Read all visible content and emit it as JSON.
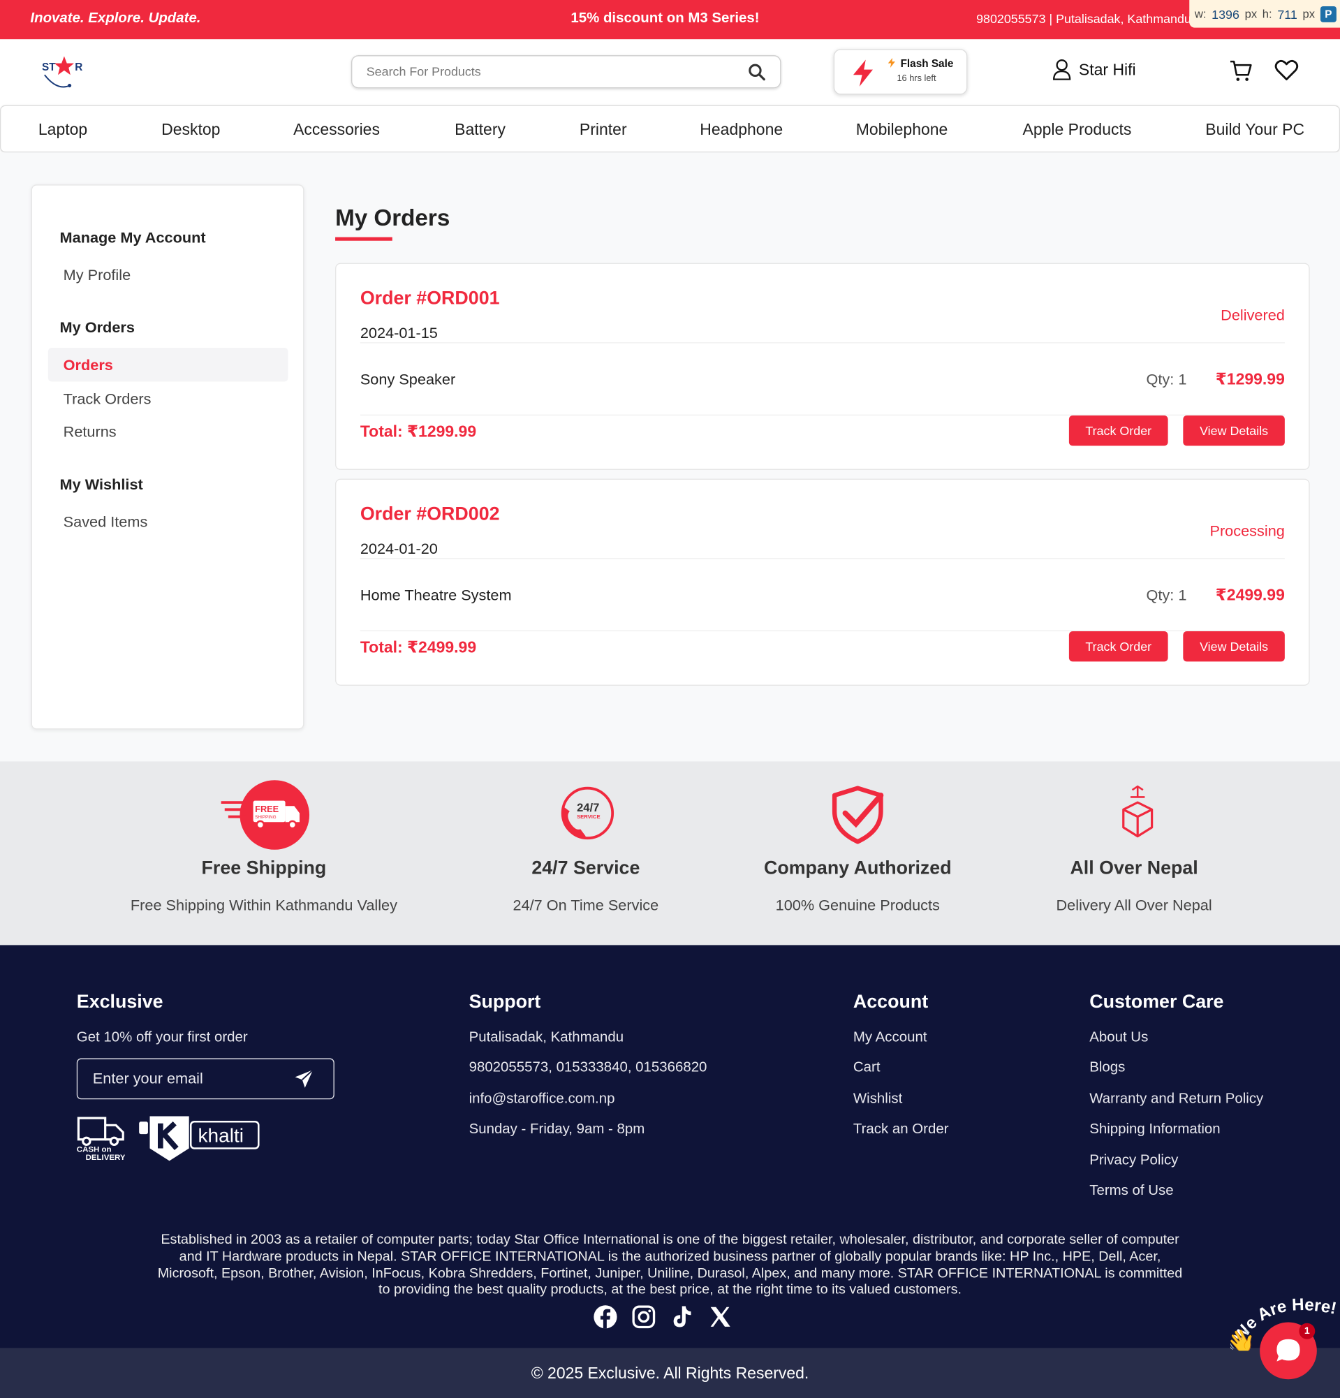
{
  "topbar": {
    "slogan": "Inovate. Explore. Update.",
    "promo": "15% discount on M3 Series!",
    "contact": "9802055573 | Putalisadak, Kathmandu",
    "dim_w_label": "w:",
    "dim_w_value": "1396",
    "dim_h_label": "h:",
    "dim_h_value": "711",
    "dim_unit": "px"
  },
  "header": {
    "search_placeholder": "Search For Products",
    "flash_title": "Flash Sale",
    "flash_sub": "16 hrs left",
    "user_name": "Star Hifi"
  },
  "nav": [
    "Laptop",
    "Desktop",
    "Accessories",
    "Battery",
    "Printer",
    "Headphone",
    "Mobilephone",
    "Apple Products",
    "Build Your PC"
  ],
  "sidebar": {
    "manage_title": "Manage My Account",
    "my_profile": "My Profile",
    "orders_title": "My Orders",
    "orders": "Orders",
    "track_orders": "Track Orders",
    "returns": "Returns",
    "wishlist_title": "My Wishlist",
    "saved_items": "Saved Items"
  },
  "page": {
    "title": "My Orders"
  },
  "orders": [
    {
      "id": "Order #ORD001",
      "date": "2024-01-15",
      "status": "Delivered",
      "item": "Sony Speaker",
      "qty": "Qty: 1",
      "price": "₹1299.99",
      "total": "Total: ₹1299.99",
      "track_label": "Track Order",
      "view_label": "View Details"
    },
    {
      "id": "Order #ORD002",
      "date": "2024-01-20",
      "status": "Processing",
      "item": "Home Theatre System",
      "qty": "Qty: 1",
      "price": "₹2499.99",
      "total": "Total: ₹2499.99",
      "track_label": "Track Order",
      "view_label": "View Details"
    }
  ],
  "features": [
    {
      "title": "Free Shipping",
      "sub": "Free Shipping Within Kathmandu Valley",
      "icon_text": "FREE",
      "icon_sub": "SHIPPING"
    },
    {
      "title": "24/7 Service",
      "sub": "24/7 On Time Service",
      "icon_text": "24/7",
      "icon_sub": "SERVICE"
    },
    {
      "title": "Company Authorized",
      "sub": "100% Genuine Products"
    },
    {
      "title": "All Over Nepal",
      "sub": "Delivery All Over Nepal"
    }
  ],
  "footer": {
    "exclusive": {
      "title": "Exclusive",
      "offer": "Get 10% off your first order",
      "email_placeholder": "Enter your email",
      "cod_line1": "CASH on",
      "cod_line2": "DELIVERY",
      "khalti": "khalti"
    },
    "support": {
      "title": "Support",
      "address": "Putalisadak, Kathmandu",
      "phones": "9802055573, 015333840, 015366820",
      "email": "info@staroffice.com.np",
      "hours": "Sunday - Friday, 9am - 8pm"
    },
    "account": {
      "title": "Account",
      "links": [
        "My Account",
        "Cart",
        "Wishlist",
        "Track an Order"
      ]
    },
    "care": {
      "title": "Customer Care",
      "links": [
        "About Us",
        "Blogs",
        "Warranty and Return Policy",
        "Shipping Information",
        "Privacy Policy",
        "Terms of Use"
      ]
    },
    "about": "Established in 2003 as a retailer of computer parts; today Star Office International is one of the biggest retailer, wholesaler, distributor, and corporate seller of computer and IT Hardware products in Nepal. STAR OFFICE INTERNATIONAL is the authorized business partner of globally popular brands like: HP Inc., HPE, Dell, Acer, Microsoft, Epson, Brother, Avision, InFocus, Kobra Shredders, Fortinet, Juniper, Uniline, Durasol, Alpex, and many more. STAR OFFICE INTERNATIONAL is committed to providing the best quality products, at the best price, at the right time to its valued customers.",
    "copyright": "© 2025 Exclusive. All Rights Reserved."
  },
  "chat": {
    "badge": "1",
    "wave_text": "We Are Here!"
  },
  "colors": {
    "accent": "#f0293e",
    "footer_bg": "#0f1438",
    "copy_bg": "#282d4a",
    "feature_bg": "#e9eaec"
  },
  "logo": {
    "text_left": "ST",
    "text_right": "R"
  }
}
